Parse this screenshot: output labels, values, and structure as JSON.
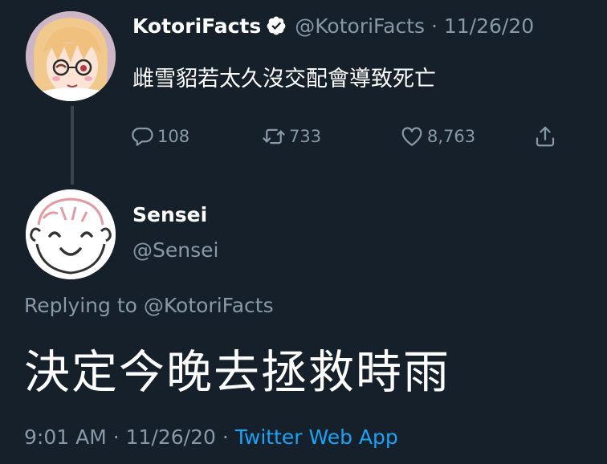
{
  "tweet": {
    "author_name": "KotoriFacts",
    "author_handle": "@KotoriFacts",
    "date_sep": " · ",
    "date": "11/26/20",
    "text": "雌雪貂若太久沒交配會導致死亡",
    "replies": "108",
    "retweets": "733",
    "likes": "8,763"
  },
  "reply": {
    "author_name": "Sensei",
    "author_handle": "@Sensei",
    "replying_prefix": "Replying to ",
    "replying_to": "@KotoriFacts",
    "text": "決定今晚去拯救時雨",
    "time": "9:01 AM",
    "sep1": " · ",
    "date": "11/26/20",
    "sep2": " · ",
    "source": "Twitter Web App"
  },
  "icons": {
    "verified": "verified-badge-icon",
    "reply": "reply-icon",
    "retweet": "retweet-icon",
    "like": "heart-icon",
    "share": "share-icon"
  },
  "colors": {
    "background": "#15202b",
    "secondary_text": "#8899a6",
    "link": "#1da1f2"
  }
}
